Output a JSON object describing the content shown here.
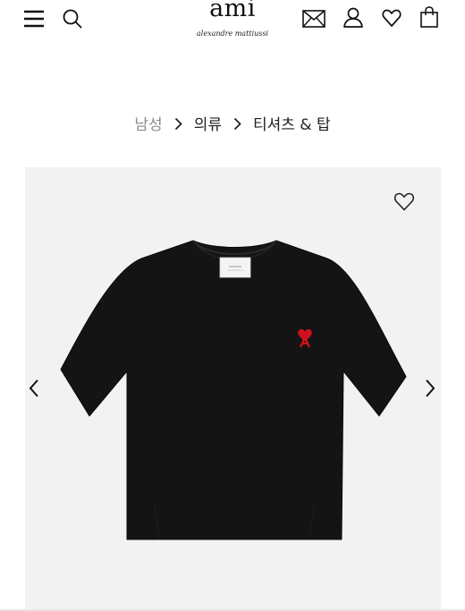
{
  "header": {
    "logo_main": "ami",
    "logo_sub": "alexandre mattiussi",
    "icons": [
      "menu-icon",
      "search-icon",
      "mail-icon",
      "user-icon",
      "heart-icon",
      "shopping-bag-icon"
    ]
  },
  "breadcrumb": {
    "items": [
      "남성",
      "의류",
      "티셔츠 & 탑"
    ]
  },
  "product": {
    "icons": [
      "heart-outline-icon",
      "chevron-left-icon",
      "chevron-right-icon"
    ],
    "colors": {
      "background": "#f2f2f2",
      "garment": "#141414",
      "logo_heart": "#d0101e"
    }
  }
}
